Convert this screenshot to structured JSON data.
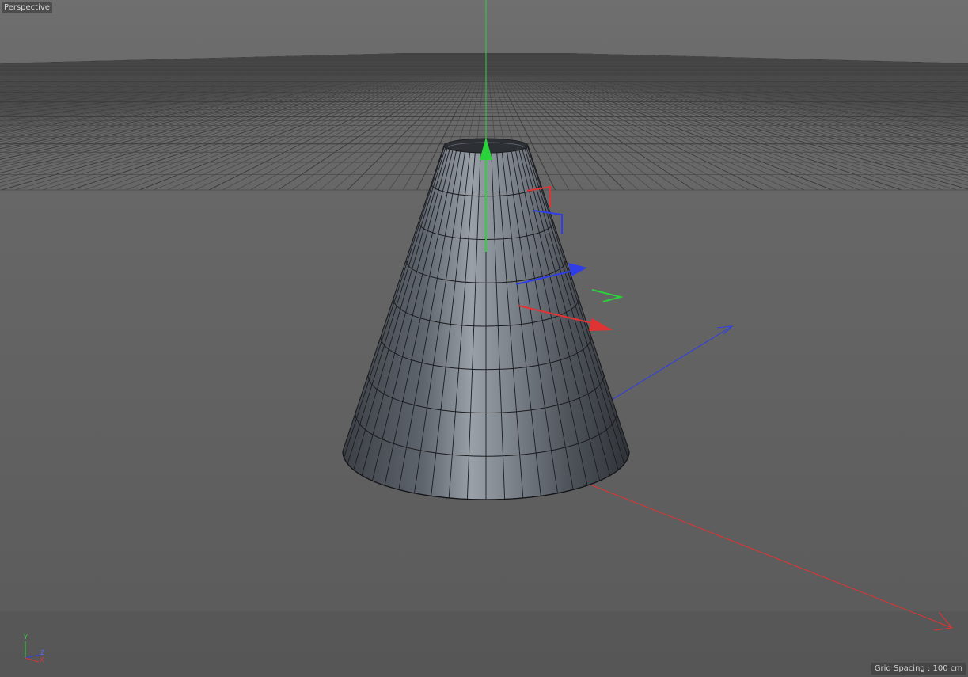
{
  "viewport": {
    "view_label": "Perspective",
    "grid_spacing_text": "Grid Spacing : 100 cm"
  },
  "axis_indicator": {
    "y": "Y",
    "z": "Z",
    "x": "X"
  },
  "colors": {
    "background": "#5e5e5e",
    "grid_line": "#474747",
    "x_axis": "#e03434",
    "y_axis": "#2bd33a",
    "z_axis": "#2f3ee6"
  },
  "icons": [
    "move-handle-icon",
    "axis-indicator-icon"
  ]
}
